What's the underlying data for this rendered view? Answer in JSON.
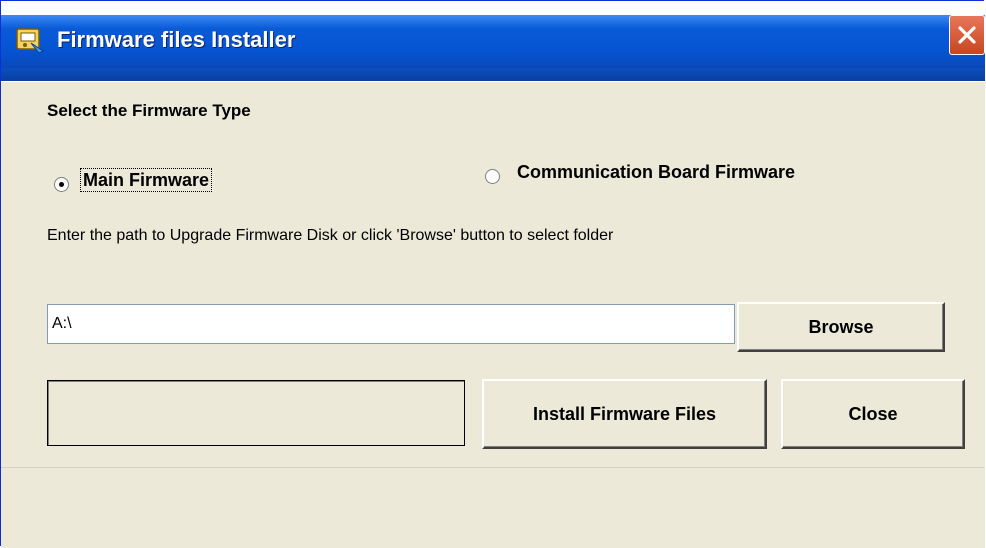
{
  "window": {
    "title": "Firmware files Installer",
    "app_icon": "installer-icon",
    "close_icon": "close-x-icon",
    "colors": {
      "titlebar": "#0a5bd8",
      "dialog_bg": "#ece9d8",
      "close_button": "#d6542f"
    }
  },
  "firmware_type": {
    "group_title": "Select the Firmware Type",
    "options": [
      {
        "label": "Main Firmware",
        "selected": true
      },
      {
        "label": "Communication Board Firmware",
        "selected": false
      }
    ]
  },
  "instructions": "Enter the path to Upgrade Firmware Disk or click 'Browse' button to select folder",
  "path_input": {
    "value": "A:\\"
  },
  "buttons": {
    "browse": "Browse",
    "install": "Install Firmware Files",
    "close": "Close"
  },
  "status_text": ""
}
